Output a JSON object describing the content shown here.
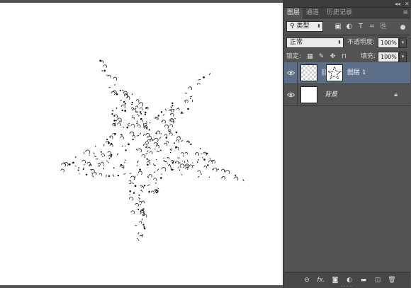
{
  "panel": {
    "tabs": [
      {
        "label": "图层",
        "active": true
      },
      {
        "label": "通道",
        "active": false
      },
      {
        "label": "历史记录",
        "active": false
      }
    ],
    "filter": {
      "kind_label": "类型",
      "icons": [
        "image-filter-icon",
        "adjustment-filter-icon",
        "text-filter-icon",
        "shape-filter-icon",
        "smart-object-filter-icon"
      ]
    },
    "blend_mode": "正常",
    "opacity": {
      "label": "不透明度:",
      "value": "100%"
    },
    "lock": {
      "label": "锁定:",
      "icons": [
        "lock-transparent-icon",
        "lock-pixels-icon",
        "lock-position-icon",
        "lock-all-icon"
      ]
    },
    "fill": {
      "label": "填充:",
      "value": "100%"
    },
    "layers": [
      {
        "name": "图层 1",
        "selected": true,
        "visible": true,
        "has_mask": true
      },
      {
        "name": "背景",
        "selected": false,
        "visible": true,
        "locked": true
      }
    ],
    "bottom_icons": [
      "link-layers-icon",
      "fx-icon",
      "add-mask-icon",
      "adjustment-layer-icon",
      "new-group-icon",
      "new-layer-icon",
      "delete-layer-icon"
    ]
  },
  "colors": {
    "selected_layer": "#5d6f88",
    "panel_bg": "#535353",
    "canvas_bg": "#ffffff"
  }
}
